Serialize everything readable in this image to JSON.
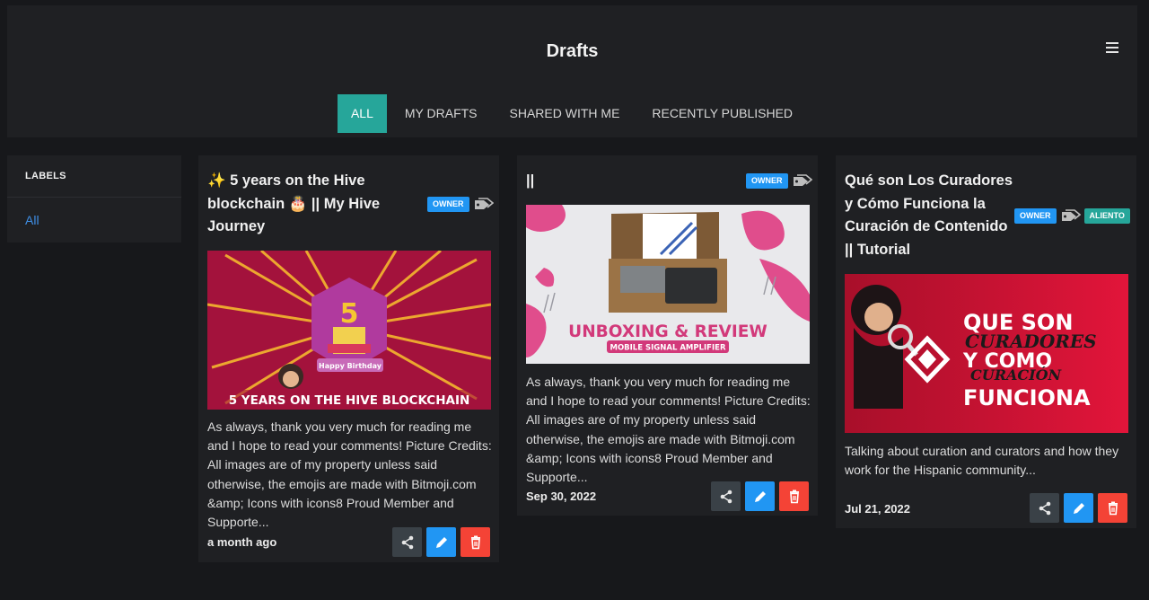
{
  "header": {
    "title": "Drafts",
    "tabs": [
      {
        "label": "ALL",
        "active": true
      },
      {
        "label": "MY DRAFTS",
        "active": false
      },
      {
        "label": "SHARED WITH ME",
        "active": false
      },
      {
        "label": "RECENTLY PUBLISHED",
        "active": false
      }
    ]
  },
  "sidebar": {
    "title": "LABELS",
    "items": [
      "All"
    ]
  },
  "cards": [
    {
      "title": "✨ 5 years on the Hive blockchain 🎂 || My Hive Journey",
      "badges": [
        "OWNER"
      ],
      "image_text": "5 YEARS ON THE HIVE BLOCKCHAIN",
      "image_caption": "Happy Birthday",
      "image_digit": "5",
      "excerpt": "As always, thank you very much for reading me and I hope to read your comments! Picture Credits: All images are of my property unless said otherwise, the emojis are made with Bitmoji.com &amp; Icons with icons8 Proud Member and Supporte...",
      "date": "a month ago"
    },
    {
      "title": "||",
      "badges": [
        "OWNER"
      ],
      "image_text": "UNBOXING & REVIEW",
      "image_caption": "MOBILE SIGNAL AMPLIFIER",
      "excerpt": "As always, thank you very much for reading me and I hope to read your comments! Picture Credits: All images are of my property unless said otherwise, the emojis are made with Bitmoji.com &amp; Icons with icons8 Proud Member and Supporte...",
      "date": "Sep 30, 2022"
    },
    {
      "title": "Qué son Los Curadores y Cómo Funciona la Curación de Contenido || Tutorial",
      "badges": [
        "OWNER",
        "ALIENTO"
      ],
      "image_lines": [
        "QUE SON",
        "CURADORES",
        "Y COMO",
        "CURACIÓN",
        "FUNCIONA"
      ],
      "excerpt": "Talking about curation and curators and how they work for the Hispanic community...",
      "date": "Jul 21, 2022"
    }
  ],
  "colors": {
    "accent": "#26a69a",
    "owner_badge": "#2196f3",
    "edit": "#2196f3",
    "delete": "#f44336",
    "share": "#3a4147",
    "link": "#3f8fe6"
  },
  "icons": [
    "menu-icon",
    "tag-icon",
    "share-icon",
    "pencil-icon",
    "trash-icon"
  ]
}
